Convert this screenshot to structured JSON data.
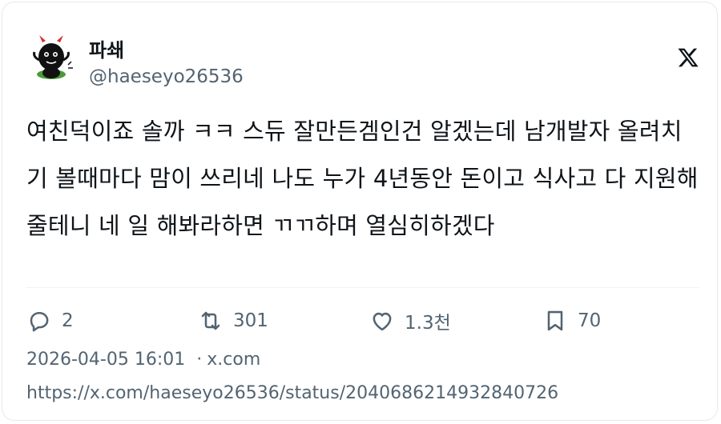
{
  "author": {
    "display_name": "파쇄",
    "handle": "@haeseyo26536",
    "avatar_icon": "devil-character-avatar"
  },
  "platform_icon": "x-logo-icon",
  "tweet": {
    "text": "여친덕이죠 솔까 ㅋㅋ 스듀 잘만든겜인건 알겠는데 남개발자 올려치기 볼때마다 맘이 쓰리네 나도 누가 4년동안 돈이고 식사고 다 지원해줄테니 네 일 해봐라하면 ㄲㄲ하며 열심히하겠다"
  },
  "actions": {
    "reply": {
      "icon": "reply-bubble-icon",
      "count": "2"
    },
    "repost": {
      "icon": "repost-icon",
      "count": "301"
    },
    "like": {
      "icon": "heart-icon",
      "count": "1.3천"
    },
    "bookmark": {
      "icon": "bookmark-icon",
      "count": "70"
    }
  },
  "meta": {
    "timestamp": "2026-04-05 16:01",
    "separator": "·",
    "source": "x.com"
  },
  "url": "https://x.com/haeseyo26536/status/2040686214932840726",
  "colors": {
    "text": "#0f1419",
    "secondary": "#536471",
    "border": "#e6e8eb"
  }
}
